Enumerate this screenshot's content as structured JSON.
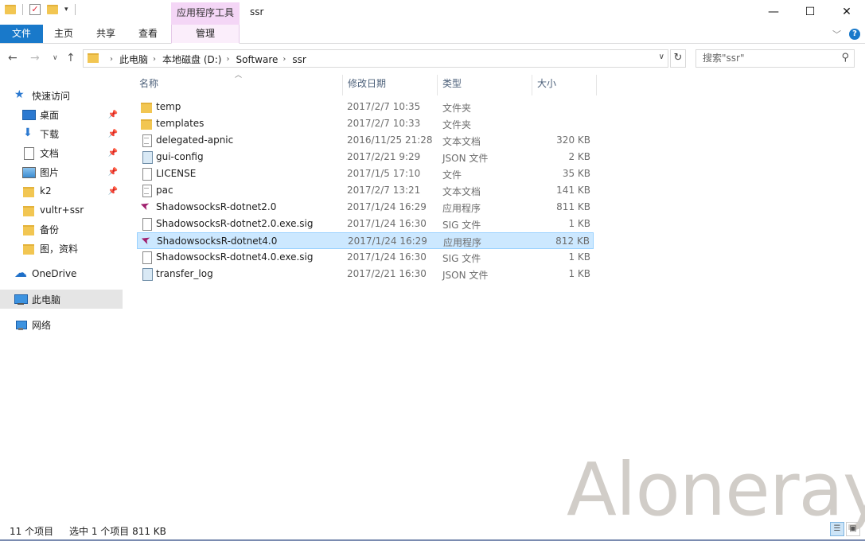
{
  "window": {
    "title": "ssr",
    "context_tab_header": "应用程序工具",
    "controls": {
      "minimize": "—",
      "maximize": "☐",
      "close": "✕"
    }
  },
  "ribbon": {
    "tabs": [
      "文件",
      "主页",
      "共享",
      "查看",
      "管理"
    ],
    "help": "?"
  },
  "address": {
    "crumbs": [
      "此电脑",
      "本地磁盘 (D:)",
      "Software",
      "ssr"
    ]
  },
  "search": {
    "placeholder": "搜索\"ssr\""
  },
  "sidebar": {
    "quick_access": "快速访问",
    "items": [
      {
        "label": "桌面",
        "icon": "desktop-icon",
        "pinned": true
      },
      {
        "label": "下载",
        "icon": "download-icon",
        "pinned": true
      },
      {
        "label": "文档",
        "icon": "documents-icon",
        "pinned": true
      },
      {
        "label": "图片",
        "icon": "pictures-icon",
        "pinned": true
      },
      {
        "label": "k2",
        "icon": "folder-icon",
        "pinned": true
      },
      {
        "label": "vultr+ssr",
        "icon": "folder-icon",
        "pinned": false
      },
      {
        "label": "备份",
        "icon": "folder-icon",
        "pinned": false
      },
      {
        "label": "图，资料",
        "icon": "folder-icon",
        "pinned": false
      }
    ],
    "onedrive": "OneDrive",
    "this_pc": "此电脑",
    "network": "网络"
  },
  "columns": {
    "name": "名称",
    "date": "修改日期",
    "type": "类型",
    "size": "大小"
  },
  "files": [
    {
      "name": "temp",
      "date": "2017/2/7 10:35",
      "type": "文件夹",
      "size": "",
      "icon": "folder"
    },
    {
      "name": "templates",
      "date": "2017/2/7 10:33",
      "type": "文件夹",
      "size": "",
      "icon": "folder"
    },
    {
      "name": "delegated-apnic",
      "date": "2016/11/25 21:28",
      "type": "文本文档",
      "size": "320 KB",
      "icon": "text"
    },
    {
      "name": "gui-config",
      "date": "2017/2/21 9:29",
      "type": "JSON 文件",
      "size": "2 KB",
      "icon": "json"
    },
    {
      "name": "LICENSE",
      "date": "2017/1/5 17:10",
      "type": "文件",
      "size": "35 KB",
      "icon": "blank"
    },
    {
      "name": "pac",
      "date": "2017/2/7 13:21",
      "type": "文本文档",
      "size": "141 KB",
      "icon": "text"
    },
    {
      "name": "ShadowsocksR-dotnet2.0",
      "date": "2017/1/24 16:29",
      "type": "应用程序",
      "size": "811 KB",
      "icon": "app"
    },
    {
      "name": "ShadowsocksR-dotnet2.0.exe.sig",
      "date": "2017/1/24 16:30",
      "type": "SIG 文件",
      "size": "1 KB",
      "icon": "blank"
    },
    {
      "name": "ShadowsocksR-dotnet4.0",
      "date": "2017/1/24 16:29",
      "type": "应用程序",
      "size": "812 KB",
      "icon": "app",
      "selected": true
    },
    {
      "name": "ShadowsocksR-dotnet4.0.exe.sig",
      "date": "2017/1/24 16:30",
      "type": "SIG 文件",
      "size": "1 KB",
      "icon": "blank"
    },
    {
      "name": "transfer_log",
      "date": "2017/2/21 16:30",
      "type": "JSON 文件",
      "size": "1 KB",
      "icon": "json"
    }
  ],
  "status": {
    "count": "11 个项目",
    "selection": "选中 1 个项目  811 KB"
  },
  "watermark": "Aloneray",
  "colors": {
    "accent": "#1979ca",
    "context_tab": "#f4d6f6",
    "selection": "#cce8ff"
  }
}
